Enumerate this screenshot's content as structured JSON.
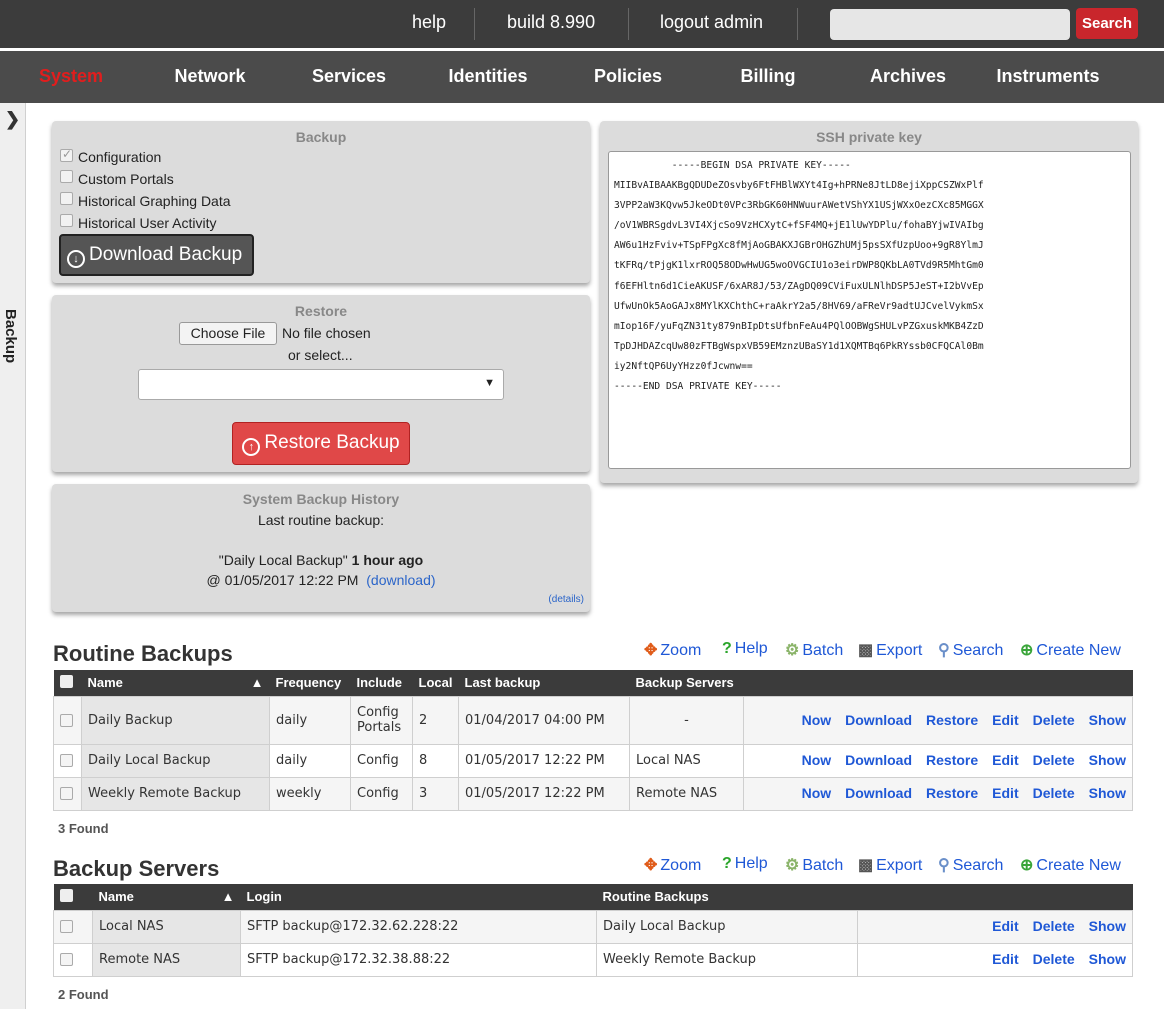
{
  "topbar": {
    "help": "help",
    "build": "build 8.990",
    "logout": "logout admin",
    "search_button": "Search",
    "search_placeholder": ""
  },
  "nav": {
    "items": [
      "System",
      "Network",
      "Services",
      "Identities",
      "Policies",
      "Billing",
      "Archives",
      "Instruments"
    ],
    "active": "System",
    "active_color": "#e21d1d"
  },
  "sidebar": {
    "label": "Backup"
  },
  "backup_panel": {
    "title": "Backup",
    "options": [
      {
        "label": "Configuration",
        "checked": true
      },
      {
        "label": "Custom Portals",
        "checked": false
      },
      {
        "label": "Historical Graphing Data",
        "checked": false
      },
      {
        "label": "Historical User Activity",
        "checked": false
      }
    ],
    "download_button": "Download Backup"
  },
  "restore_panel": {
    "title": "Restore",
    "choose_file": "Choose File",
    "no_file": "No file chosen",
    "or_select": "or select...",
    "select_value": "",
    "restore_button": "Restore Backup"
  },
  "history_panel": {
    "title": "System Backup History",
    "last_routine": "Last routine backup:",
    "backup_name": "\"Daily Local Backup\"",
    "ago": "1 hour ago",
    "at": "@ 01/05/2017 12:22 PM",
    "download": "(download)",
    "details": "(details)"
  },
  "ssh_panel": {
    "title": "SSH private key",
    "key_lines": [
      "          -----BEGIN DSA PRIVATE KEY-----",
      "MIIBvAIBAAKBgQDUDeZOsvby6FtFHBlWXYt4Ig+hPRNe8JtLD8ejiXppCSZWxPlf",
      "3VPP2aW3KQvw5JkeODt0VPc3RbGK60HNWuurAWetVShYX1USjWXxOezCXc85MGGX",
      "/oV1WBRSgdvL3VI4XjcSo9VzHCXytC+fSF4MQ+jE1lUwYDPlu/fohaBYjwIVAIbg",
      "AW6u1HzFviv+TSpFPgXc8fMjAoGBAKXJGBrOHGZhUMj5psSXfUzpUoo+9gR8YlmJ",
      "tKFRq/tPjgK1lxrROQ58ODwHwUG5woOVGCIU1o3eirDWP8QKbLA0TVd9R5MhtGm0",
      "f6EFHltn6d1CieAKUSF/6xAR8J/53/ZAgDQ09CViFuxULNlhDSP5JeST+I2bVvEp",
      "UfwUnOk5AoGAJx8MYlKXChthC+raAkrY2a5/8HV69/aFReVr9adtUJCvelVykmSx",
      "mIop16F/yuFqZN31ty879nBIpDtsUfbnFeAu4PQlOOBWgSHULvPZGxuskMKB4ZzD",
      "TpDJHDAZcqUw80zFTBgWspxVB59EMznzUBaSY1d1XQMTBq6PkRYssb0CFQCAl0Bm",
      "iy2NftQP6UyYHzz0fJcwnw==",
      "-----END DSA PRIVATE KEY-----"
    ]
  },
  "toolbar": {
    "zoom": "Zoom",
    "help": "Help",
    "batch": "Batch",
    "export": "Export",
    "search": "Search",
    "create": "Create New"
  },
  "routine_backups": {
    "title": "Routine Backups",
    "columns": [
      "Name",
      "Frequency",
      "Include",
      "Local",
      "Last backup",
      "Backup Servers"
    ],
    "rows": [
      {
        "name": "Daily Backup",
        "frequency": "daily",
        "include1": "Config",
        "include2": "Portals",
        "local": "2",
        "last": "01/04/2017 04:00 PM",
        "servers": "-"
      },
      {
        "name": "Daily Local Backup",
        "frequency": "daily",
        "include1": "Config",
        "include2": "",
        "local": "8",
        "last": "01/05/2017 12:22 PM",
        "servers": "Local NAS"
      },
      {
        "name": "Weekly Remote Backup",
        "frequency": "weekly",
        "include1": "Config",
        "include2": "",
        "local": "3",
        "last": "01/05/2017 12:22 PM",
        "servers": "Remote NAS"
      }
    ],
    "actions": [
      "Now",
      "Download",
      "Restore",
      "Edit",
      "Delete",
      "Show"
    ],
    "found": "3 Found"
  },
  "backup_servers": {
    "title": "Backup Servers",
    "columns": [
      "Name",
      "Login",
      "Routine Backups"
    ],
    "rows": [
      {
        "name": "Local NAS",
        "login": "SFTP backup@172.32.62.228:22",
        "routine": "Daily Local Backup"
      },
      {
        "name": "Remote NAS",
        "login": "SFTP backup@172.32.38.88:22",
        "routine": "Weekly Remote Backup"
      }
    ],
    "actions": [
      "Edit",
      "Delete",
      "Show"
    ],
    "found": "2 Found"
  },
  "icons": {
    "zoom": "zoom-arrows-icon",
    "help": "question-icon",
    "batch": "gear-icon",
    "export": "export-icon",
    "search": "magnifier-icon",
    "create": "plus-circle-icon"
  }
}
